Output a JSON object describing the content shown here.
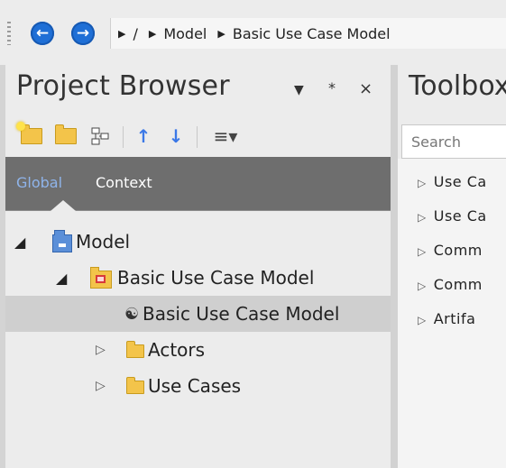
{
  "breadcrumb": {
    "back_icon": "arrow-left",
    "forward_icon": "arrow-right",
    "segments": [
      "/",
      "Model",
      "Basic Use Case Model"
    ]
  },
  "project_browser": {
    "title": "Project Browser",
    "dropdown_glyph": "▼",
    "pin_glyph": "ᵠ",
    "close_glyph": "×",
    "toolbar": {
      "up_glyph": "↑",
      "down_glyph": "↓",
      "menu_glyph": "≡▾"
    },
    "tabs": {
      "global": "Global",
      "context": "Context"
    },
    "tree": [
      {
        "label": "Model",
        "icon": "package-icon",
        "expander": "◢"
      },
      {
        "label": "Basic Use Case Model",
        "icon": "diagram-package-icon",
        "expander": "◢"
      },
      {
        "label": "Basic Use Case Model",
        "icon": "use-case-diagram-icon",
        "selected": true
      },
      {
        "label": "Actors",
        "icon": "folder-icon",
        "expander": "▷"
      },
      {
        "label": "Use Cases",
        "icon": "folder-icon",
        "expander": "▷"
      }
    ]
  },
  "toolbox": {
    "title": "Toolbox",
    "search_placeholder": "Search",
    "items": [
      "Use Ca",
      "Use Ca",
      "Comm",
      "Comm",
      "Artifa"
    ],
    "item_glyph": "▷"
  },
  "colors": {
    "tab_bar": "#6e6e6e",
    "global_tab_text": "#8fb4ea",
    "context_tab_text": "#ffffff",
    "nav_button": "#1f6fd6",
    "selection": "#cfcfcf"
  }
}
